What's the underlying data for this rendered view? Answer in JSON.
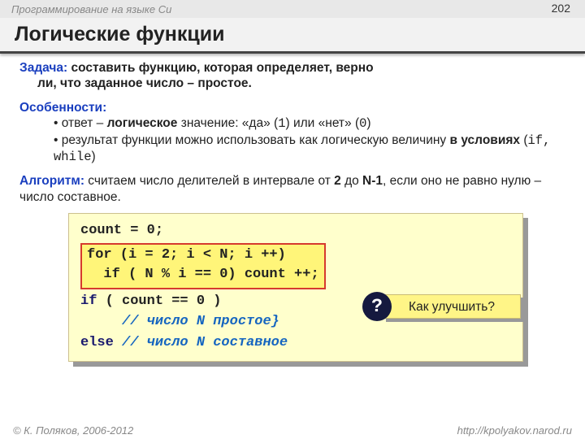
{
  "header": {
    "course": "Программирование на языке Си",
    "page_number": "202"
  },
  "title": "Логические функции",
  "task": {
    "label": "Задача:",
    "text_a": "составить функцию, которая определяет, верно",
    "text_b": "ли, что заданное число – простое."
  },
  "features": {
    "label": "Особенности:",
    "items": {
      "0a": "ответ – ",
      "0b": "логическое",
      "0c": " значение: «да» (",
      "0d": "1",
      "0e": ") или «нет» (",
      "0f": "0",
      "0g": ")",
      "1a": "результат функции можно использовать как логическую величину ",
      "1b": "в условиях",
      "1c": " (",
      "1d": "if, while",
      "1e": ")"
    }
  },
  "algo": {
    "label": "Алгоритм:",
    "text_a": "считаем число делителей в интервале от ",
    "bold2": "2",
    "text_b": " до ",
    "boldN": "N-1",
    "text_c": ", если оно не равно нулю – число составное."
  },
  "code": {
    "l1": "count = 0;",
    "l2": "for (i = 2; i < N; i ++)",
    "l3": "  if ( N % i == 0) count ++;",
    "l4a": "if",
    "l4b": " ( count == 0 )",
    "l5": "// число N простое}",
    "l6a": "else",
    "l6b": " ",
    "l6c": "// число N составное"
  },
  "callout": {
    "q": "?",
    "text": "Как улучшить?"
  },
  "footer": {
    "left": "© К. Поляков, 2006-2012",
    "right": "http://kpolyakov.narod.ru"
  }
}
